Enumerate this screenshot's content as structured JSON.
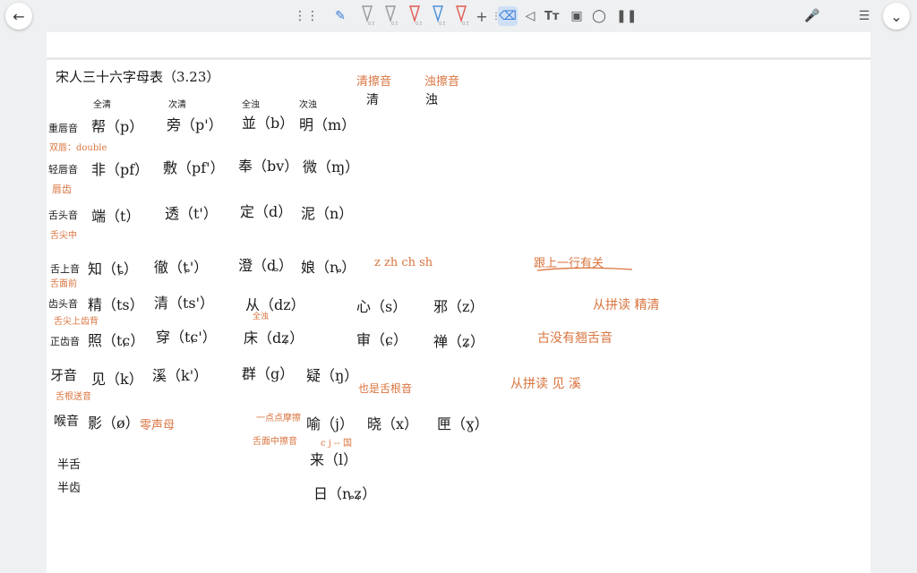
{
  "toolbar": {
    "back_icon": "arrow-left-icon",
    "collapse_icon": "chevron-down-icon",
    "menu_icon": "sidebar-menu-icon",
    "pens": [
      {
        "label": "0.5",
        "color": "#999999"
      },
      {
        "label": "0.5",
        "color": "#999999"
      },
      {
        "label": "0.5",
        "color": "#e15a52"
      },
      {
        "label": "0.5",
        "color": "#4a90d9"
      },
      {
        "label": "0.5",
        "color": "#e15a52"
      }
    ],
    "accent": "#3a7bd5"
  },
  "note": {
    "title": "宋人三十六字母表（3.23）",
    "headers": {
      "quanqing": "全清",
      "ciqing": "次清",
      "quanzhuo": "全浊",
      "cizhuo": "次浊",
      "qing_zh": "清擦音",
      "zhuo_zh": "浊擦音",
      "qing": "清",
      "zhuo": "浊"
    },
    "rows": [
      {
        "cat": "重唇音",
        "cells": [
          "帮（p）",
          "旁（p'）",
          "並（b）",
          "明（m）"
        ]
      },
      {
        "cat": "轻唇音",
        "cells": [
          "非（pf）",
          "敷（pf'）",
          "奉（bv）",
          "微（ɱ）"
        ]
      },
      {
        "cat": "舌头音",
        "cells": [
          "端（t）",
          "透（t'）",
          "定（d）",
          "泥（n）"
        ]
      },
      {
        "cat": "舌上音",
        "cells": [
          "知（ȶ）",
          "徹（ȶ'）",
          "澄（ȡ）",
          "娘（ȵ）"
        ]
      },
      {
        "cat": "齿头音",
        "cells": [
          "精（ts）",
          "清（ts'）",
          "从（dz）",
          "心（s）",
          "邪（z）"
        ]
      },
      {
        "cat": "正齿音",
        "cells": [
          "照（tɕ）",
          "穿（tɕ'）",
          "床（dʑ）",
          "审（ɕ）",
          "禅（ʑ）"
        ]
      },
      {
        "cat": "牙音",
        "cells": [
          "见（k）",
          "溪（k'）",
          "群（g）",
          "疑（ŋ）"
        ]
      },
      {
        "cat": "喉音",
        "cells": [
          "影（ø）",
          "喻（j）",
          "晓（x）",
          "匣（ɣ）"
        ]
      },
      {
        "cat": "半舌",
        "cells": [
          "来（l）"
        ]
      },
      {
        "cat": "半齿",
        "cells": [
          "日（ȵʑ）"
        ]
      }
    ],
    "annotations": {
      "shuangchun": "双唇：double",
      "chunchi": "唇齿",
      "shejianzhong": "舌尖中",
      "shemianqian": "舌面前",
      "chunzhuo": "全浊",
      "shejian_shangchi": "舌尖上齿背",
      "zh_line": "z zh ch sh",
      "gen_shang": "跟上一行有关",
      "pinyin_jingqing": "从拼读 精清",
      "gu_meiyou": "古没有翘舌音",
      "shegen": "舌根送音",
      "ye_shi": "也是舌根音",
      "pinyin_jianxi": "从拼读 见 溪",
      "lingshengmu": "零声母",
      "yidian": "一点点摩擦",
      "shemian_cayin": "舌面中擦音",
      "j_note": "c j -- 国"
    }
  }
}
